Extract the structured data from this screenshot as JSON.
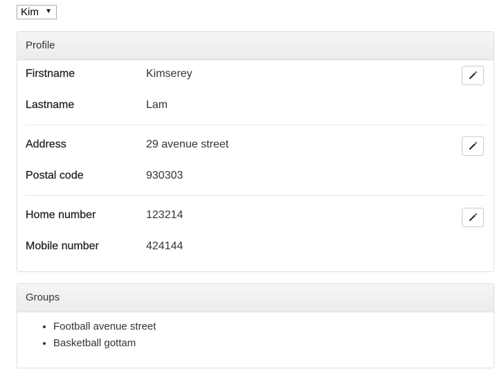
{
  "user_select": {
    "selected": "Kim",
    "caret": "▼"
  },
  "profile": {
    "title": "Profile",
    "sections": [
      {
        "fields": [
          {
            "label": "Firstname",
            "value": "Kimserey"
          },
          {
            "label": "Lastname",
            "value": "Lam"
          }
        ]
      },
      {
        "fields": [
          {
            "label": "Address",
            "value": "29 avenue street"
          },
          {
            "label": "Postal code",
            "value": "930303"
          }
        ]
      },
      {
        "fields": [
          {
            "label": "Home number",
            "value": "123214"
          },
          {
            "label": "Mobile number",
            "value": "424144"
          }
        ]
      }
    ],
    "edit_icon": "pencil-icon"
  },
  "groups": {
    "title": "Groups",
    "items": [
      "Football avenue street",
      "Basketball gottam"
    ]
  }
}
